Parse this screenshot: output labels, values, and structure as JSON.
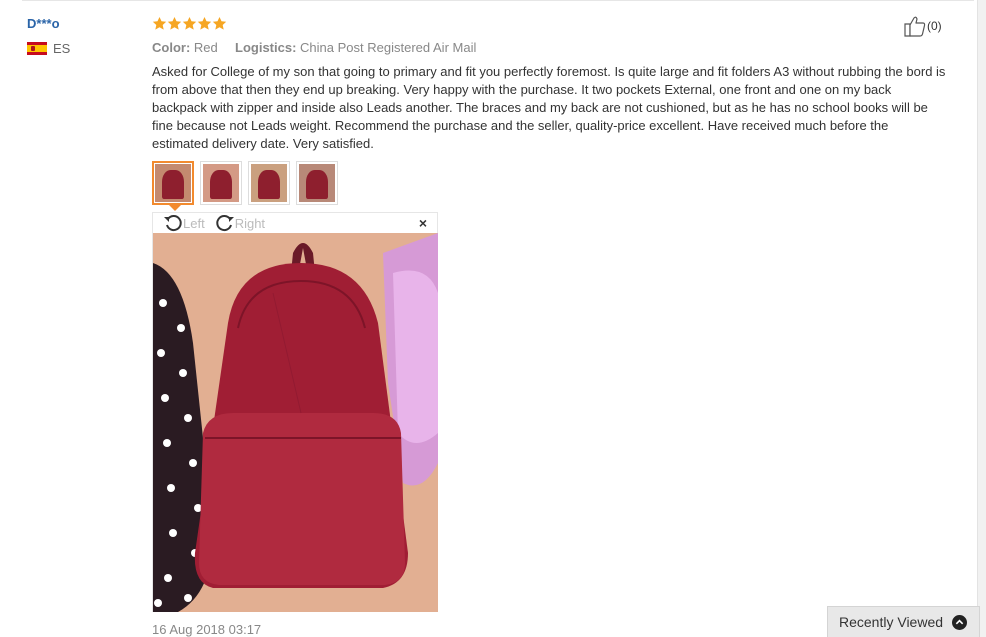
{
  "buyer": {
    "name": "D***o",
    "country_code": "ES",
    "flag_icon": "spain-flag-icon"
  },
  "review": {
    "rating": 5,
    "rating_max": 5,
    "star_color": "#f6a623",
    "color_label": "Color:",
    "color_value": "Red",
    "logistics_label": "Logistics:",
    "logistics_value": "China Post Registered Air Mail",
    "text": "Asked for College of my son that going to primary and fit you perfectly foremost. Is quite large and fit folders A3 without rubbing the bord is from above that then they end up breaking. Very happy with the purchase. It two pockets External, one front and one on my back backpack with zipper and inside also Leads another. The braces and my back are not cushioned, but as he has no school books will be fine because not Leads weight. Recommend the purchase and the seller, quality-price excellent. Have received much before the estimated delivery date. Very satisfied.",
    "helpful_count": "(0)",
    "date": "16 Aug 2018 03:17"
  },
  "photos": {
    "thumbnail_count": 4,
    "active_index": 0,
    "active_border_color": "#f28a2e"
  },
  "viewer": {
    "rotate_left_label": "Left",
    "rotate_right_label": "Right",
    "close_label": "×"
  },
  "recently_viewed": {
    "label": "Recently Viewed"
  }
}
